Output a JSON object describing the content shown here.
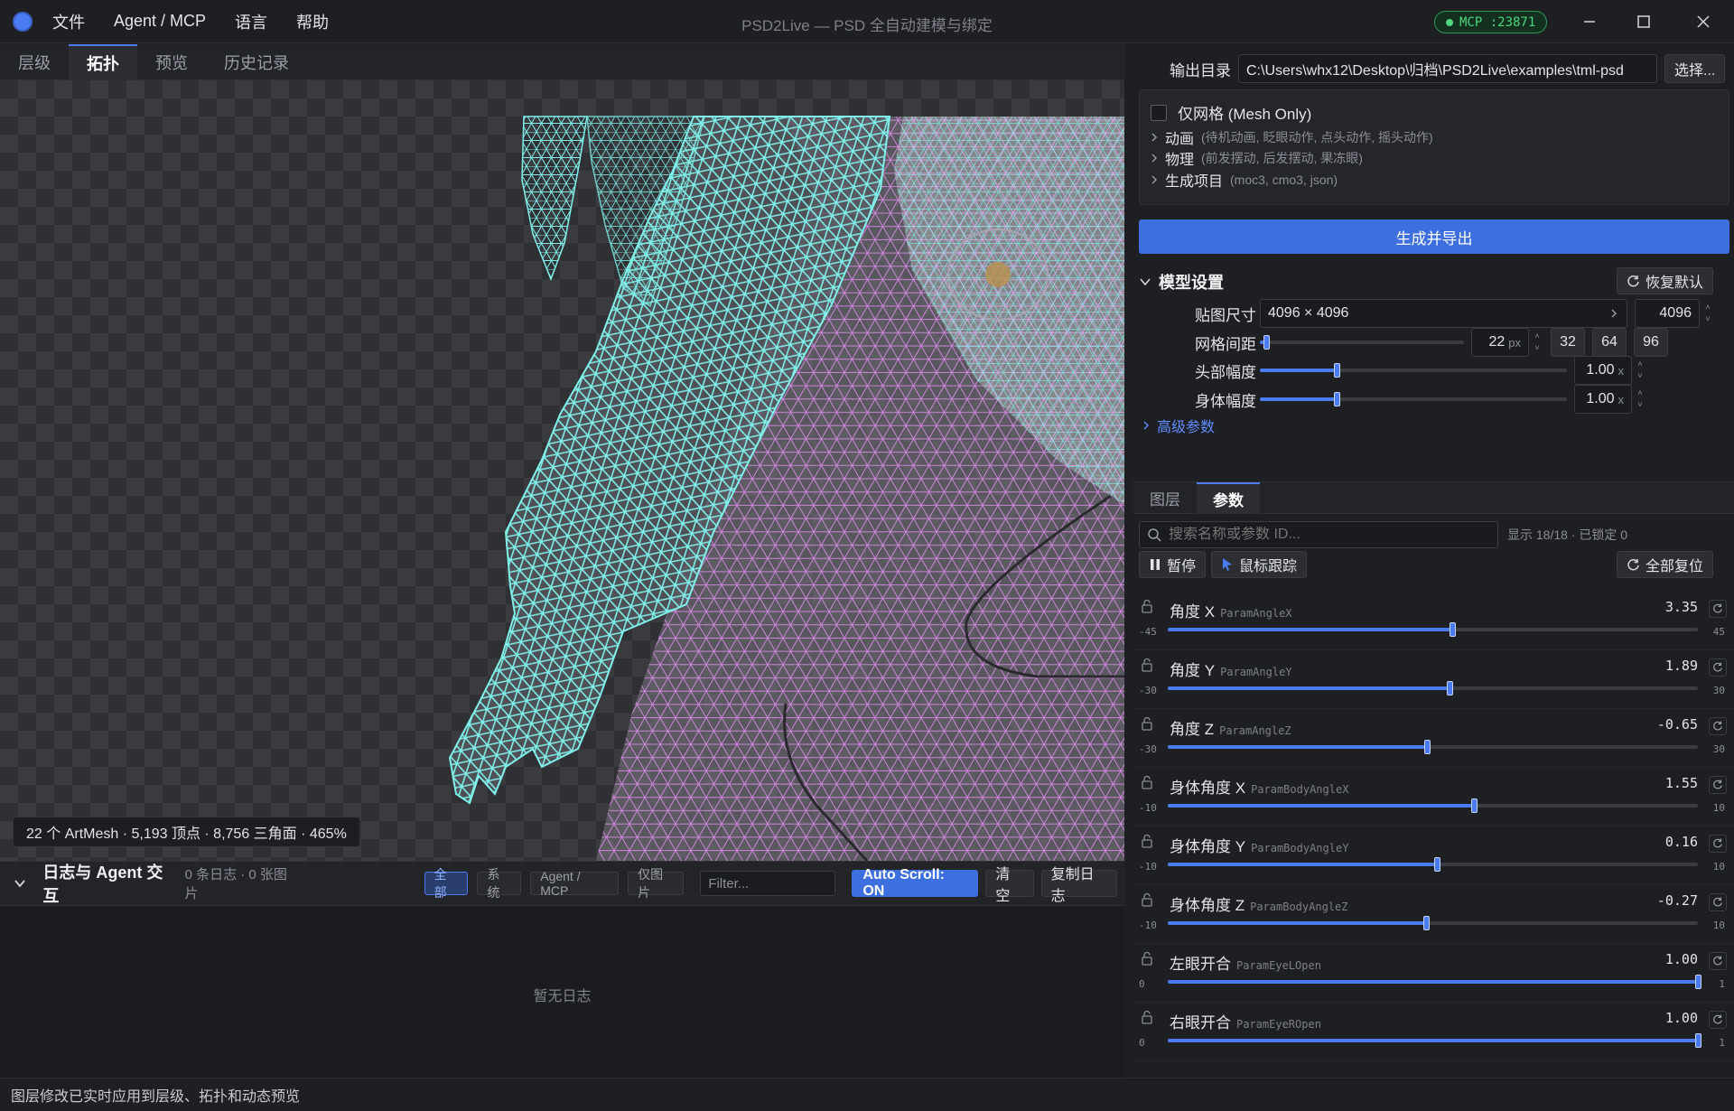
{
  "app": {
    "title": "PSD2Live — PSD 全自动建模与绑定",
    "menu": [
      "文件",
      "Agent / MCP",
      "语言",
      "帮助"
    ],
    "mcp_badge": "MCP :23871"
  },
  "left": {
    "tabs": [
      "层级",
      "拓扑",
      "预览",
      "历史记录"
    ],
    "active_tab": "拓扑",
    "stats": "22 个 ArtMesh · 5,193 顶点 · 8,756 三角面 · 465%"
  },
  "log": {
    "title": "日志与 Agent 交互",
    "counts": "0 条日志 · 0 张图片",
    "filters": [
      "全部",
      "系统",
      "Agent / MCP",
      "仅图片"
    ],
    "filter_placeholder": "Filter...",
    "autoscroll": "Auto Scroll: ON",
    "clear": "清空",
    "copy": "复制日志",
    "empty": "暂无日志"
  },
  "right": {
    "output_label": "输出目录",
    "output_path": "C:\\Users\\whx12\\Desktop\\归档\\PSD2Live\\examples\\tml-psd",
    "choose": "选择...",
    "mesh_only": "仅网格 (Mesh Only)",
    "options": [
      {
        "name": "动画",
        "desc": "(待机动画, 眨眼动作, 点头动作, 摇头动作)"
      },
      {
        "name": "物理",
        "desc": "(前发摆动, 后发摆动, 果冻眼)"
      },
      {
        "name": "生成项目",
        "desc": "(moc3, cmo3, json)"
      }
    ],
    "generate": "生成并导出",
    "model_settings": "模型设置",
    "restore": "恢复默认",
    "texture_label": "贴图尺寸",
    "texture_value": "4096 × 4096",
    "texture_spin": "4096",
    "grid_label": "网格间距",
    "grid_value": "22",
    "grid_unit": "px",
    "grid_fraction": 0.03,
    "grid_presets": [
      "32",
      "64",
      "96"
    ],
    "head_label": "头部幅度",
    "head_value": "1.00",
    "head_fraction": 0.25,
    "body_label": "身体幅度",
    "body_value": "1.00",
    "body_fraction": 0.25,
    "scale_unit": "x",
    "advanced": "高级参数",
    "tabs": [
      "图层",
      "参数"
    ],
    "active_tab": "参数",
    "search_placeholder": "搜索名称或参数 ID...",
    "display_count": "显示 18/18 · 已锁定 0",
    "pause": "暂停",
    "mouse_track": "鼠标跟踪",
    "reset_all": "全部复位"
  },
  "params": [
    {
      "name": "角度 X",
      "id": "ParamAngleX",
      "value": "3.35",
      "min": "-45",
      "max": "45",
      "num": 3.35,
      "lo": -45,
      "hi": 45
    },
    {
      "name": "角度 Y",
      "id": "ParamAngleY",
      "value": "1.89",
      "min": "-30",
      "max": "30",
      "num": 1.89,
      "lo": -30,
      "hi": 30
    },
    {
      "name": "角度 Z",
      "id": "ParamAngleZ",
      "value": "-0.65",
      "min": "-30",
      "max": "30",
      "num": -0.65,
      "lo": -30,
      "hi": 30
    },
    {
      "name": "身体角度 X",
      "id": "ParamBodyAngleX",
      "value": "1.55",
      "min": "-10",
      "max": "10",
      "num": 1.55,
      "lo": -10,
      "hi": 10
    },
    {
      "name": "身体角度 Y",
      "id": "ParamBodyAngleY",
      "value": "0.16",
      "min": "-10",
      "max": "10",
      "num": 0.16,
      "lo": -10,
      "hi": 10
    },
    {
      "name": "身体角度 Z",
      "id": "ParamBodyAngleZ",
      "value": "-0.27",
      "min": "-10",
      "max": "10",
      "num": -0.27,
      "lo": -10,
      "hi": 10
    },
    {
      "name": "左眼开合",
      "id": "ParamEyeLOpen",
      "value": "1.00",
      "min": "0",
      "max": "1",
      "num": 1,
      "lo": 0,
      "hi": 1
    },
    {
      "name": "右眼开合",
      "id": "ParamEyeROpen",
      "value": "1.00",
      "min": "0",
      "max": "1",
      "num": 1,
      "lo": 0,
      "hi": 1
    }
  ],
  "status": "图层修改已实时应用到层级、拓扑和动态预览",
  "colors": {
    "accent": "#3d6fe0",
    "mesh_cyan": "#7ff0ea",
    "mesh_pink": "#d98ae8",
    "mcp_green": "#4dd67f"
  }
}
